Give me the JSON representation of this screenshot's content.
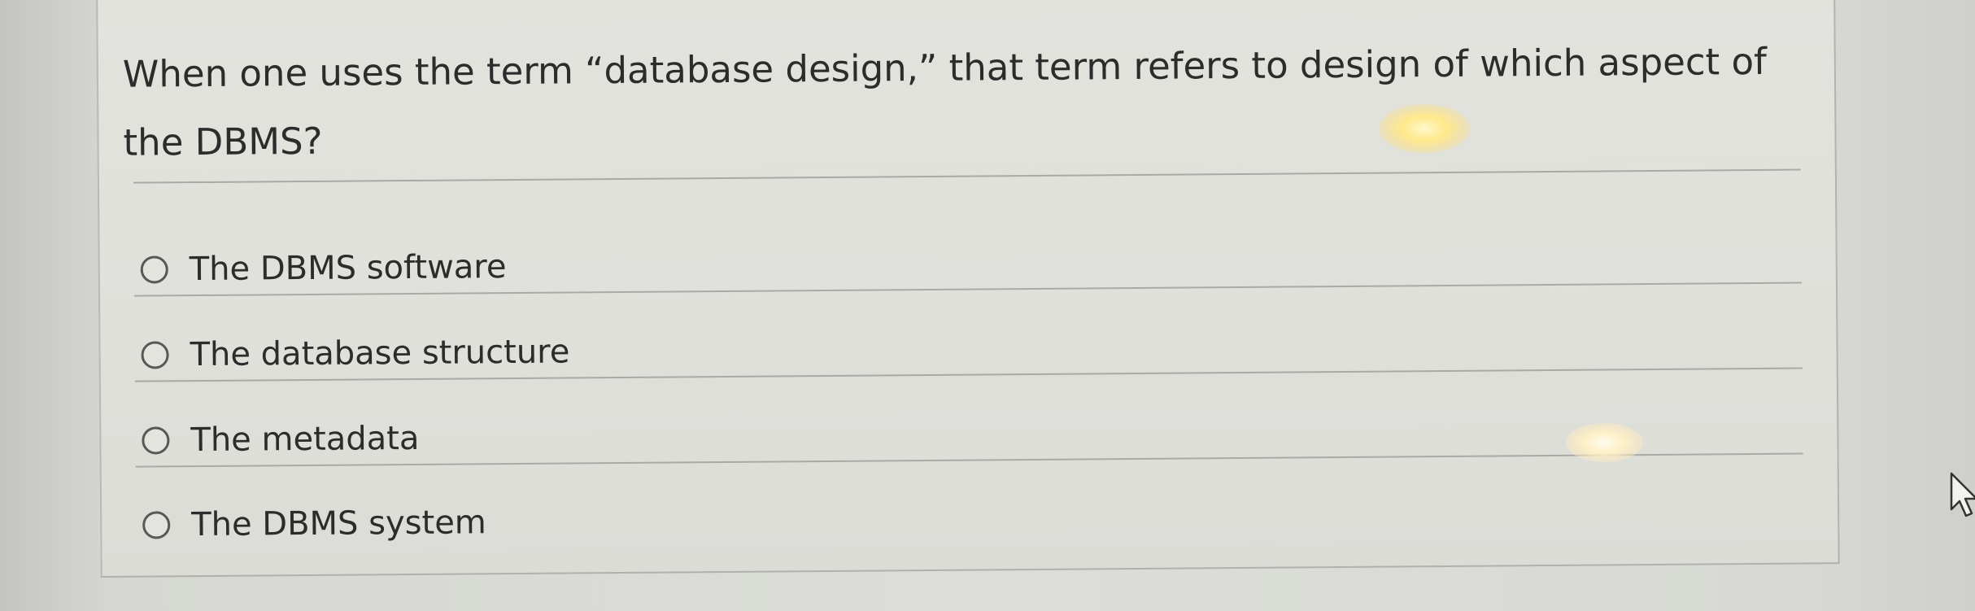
{
  "question": {
    "text": "When one uses the term “database design,” that term refers to design of which aspect of the DBMS?"
  },
  "options": [
    {
      "label": "The DBMS software",
      "selected": false
    },
    {
      "label": "The database structure",
      "selected": false
    },
    {
      "label": "The metadata",
      "selected": false
    },
    {
      "label": "The DBMS system",
      "selected": false
    }
  ],
  "icons": {
    "radio": "radio-unselected-icon",
    "cursor": "mouse-pointer-icon"
  },
  "colors": {
    "card_background": "#e1e1dc",
    "text": "#2b2c2b",
    "radio_border": "#585957",
    "divider": "#a9aaa6"
  }
}
